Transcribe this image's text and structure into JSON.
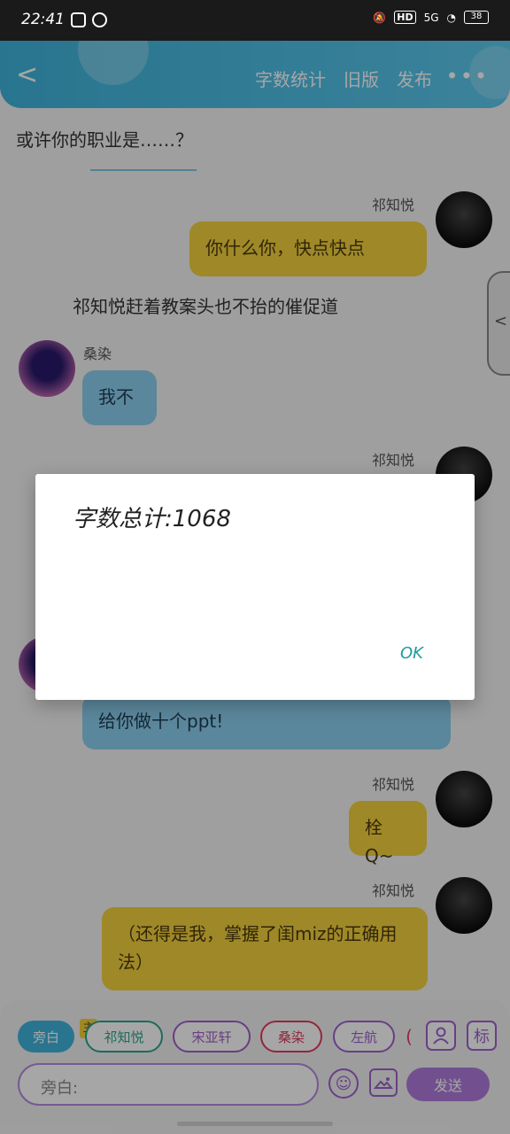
{
  "status_bar": {
    "time": "22:41",
    "network": "5G",
    "hd": "HD",
    "battery": "38"
  },
  "header": {
    "back": "<",
    "menu": [
      "字数统计",
      "旧版",
      "发布"
    ],
    "more": "•••"
  },
  "chat": {
    "top_text": "或许你的职业是……？",
    "narration1": "祁知悦赶着教案头也不抬的催促道",
    "messages": [
      {
        "name": "祁知悦",
        "text": "你什么你，快点快点"
      },
      {
        "name": "桑染",
        "text": "我不"
      },
      {
        "name": "祁知悦",
        "text": ""
      },
      {
        "name": "",
        "text": "给你做十个ppt!"
      },
      {
        "name": "祁知悦",
        "text": "栓Q~"
      },
      {
        "name": "祁知悦",
        "text": "（还得是我，掌握了闺miz的正确用法）"
      }
    ]
  },
  "dialog": {
    "message": "字数总计:1068",
    "ok": "OK"
  },
  "bottom": {
    "roles": [
      "旁白",
      "祁知悦",
      "宋亚轩",
      "桑染",
      "左航",
      "("
    ],
    "main_tag": "主",
    "input_placeholder": "旁白:",
    "send": "发送",
    "icons": {
      "person": "person-icon",
      "tag": "标",
      "emoji": "☺",
      "image": "image-icon"
    }
  }
}
